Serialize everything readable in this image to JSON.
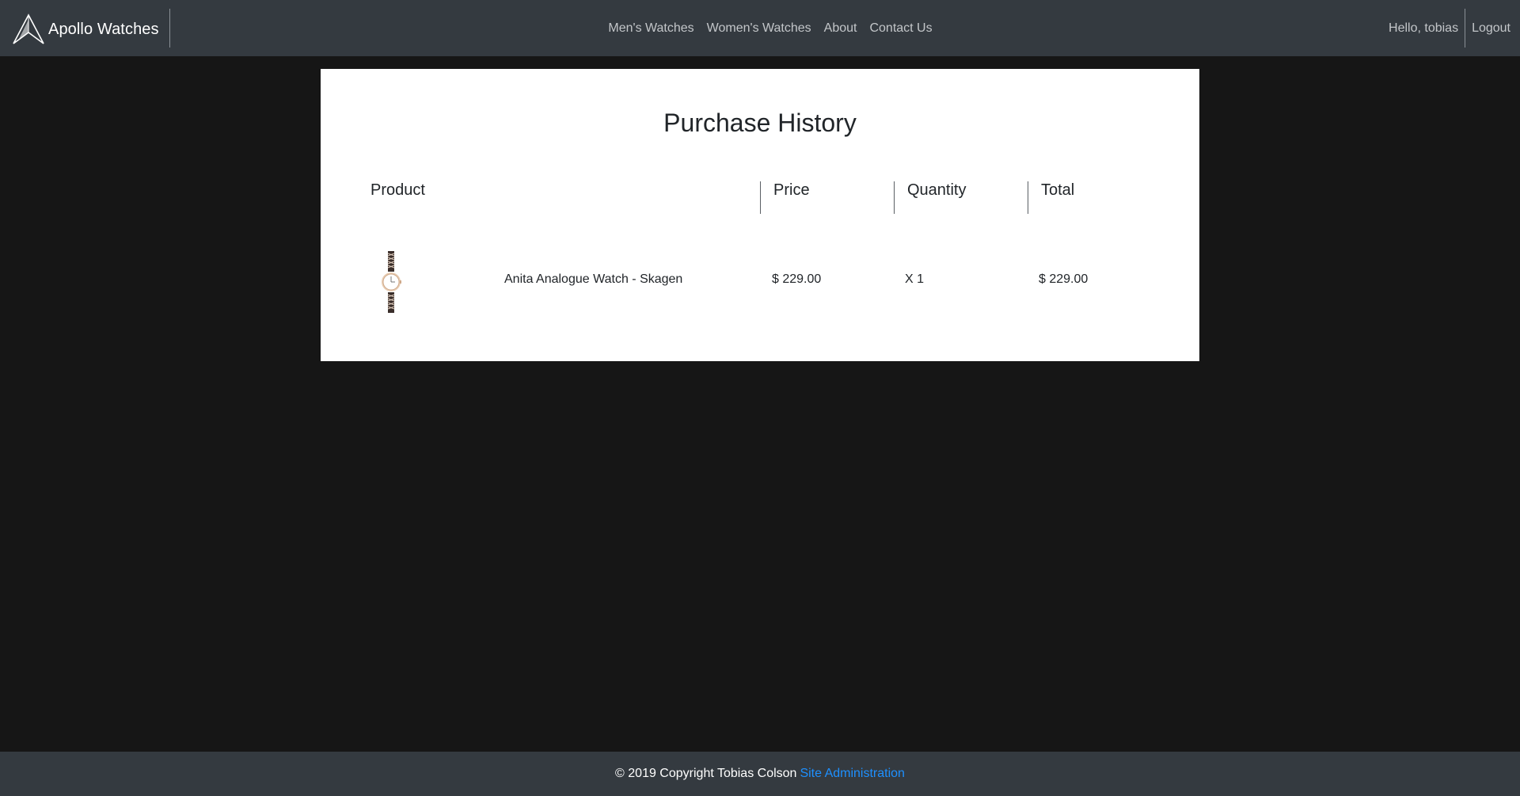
{
  "brand": {
    "name": "Apollo Watches",
    "logo_icon": "apollo-logo-icon"
  },
  "nav": {
    "links": [
      "Men's Watches",
      "Women's Watches",
      "About",
      "Contact Us"
    ],
    "greeting": "Hello, tobias",
    "logout": "Logout"
  },
  "page": {
    "title": "Purchase History",
    "columns": {
      "product": "Product",
      "price": "Price",
      "quantity": "Quantity",
      "total": "Total"
    },
    "rows": [
      {
        "image_icon": "wristwatch-image",
        "name": "Anita Analogue Watch - Skagen",
        "price": "$ 229.00",
        "quantity": "X 1",
        "total": "$ 229.00"
      }
    ]
  },
  "footer": {
    "copyright": "© 2019 Copyright Tobias Colson",
    "admin_link": "Site Administration"
  },
  "colors": {
    "navbar": "#343a40",
    "background": "#161616",
    "link_accent": "#1e90ff"
  }
}
